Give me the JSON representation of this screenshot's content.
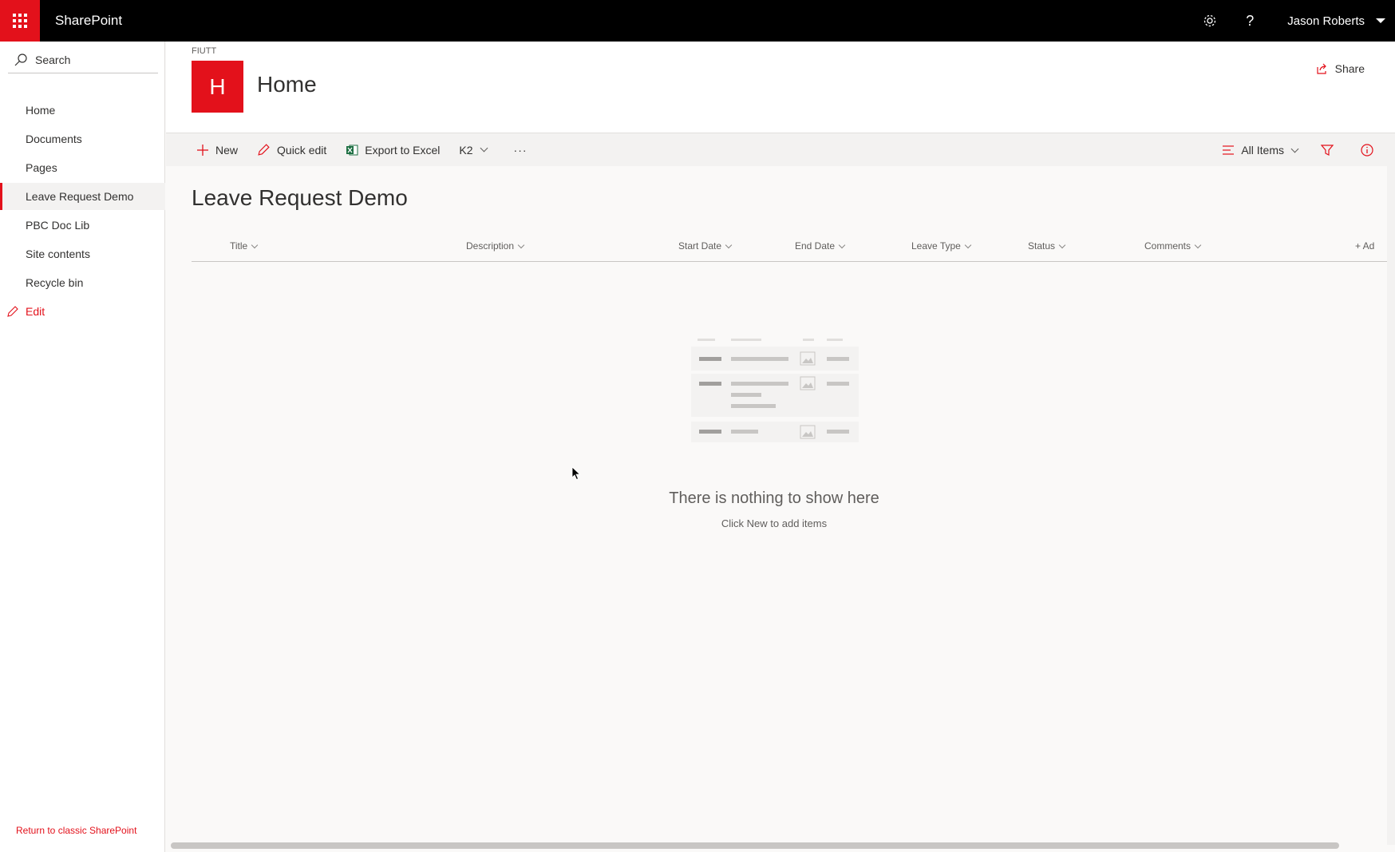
{
  "suite": {
    "app_name": "SharePoint",
    "user_name": "Jason Roberts",
    "icons": [
      "waffle-icon",
      "gear-icon",
      "help-icon",
      "chevron-down-icon"
    ]
  },
  "leftnav": {
    "search_label": "Search",
    "items": [
      {
        "label": "Home"
      },
      {
        "label": "Documents"
      },
      {
        "label": "Pages"
      },
      {
        "label": "Leave Request Demo",
        "selected": true
      },
      {
        "label": "PBC Doc Lib"
      },
      {
        "label": "Site contents"
      },
      {
        "label": "Recycle bin"
      }
    ],
    "edit_label": "Edit",
    "return_classic": "Return to classic SharePoint"
  },
  "header": {
    "breadcrumb": "FIUTT",
    "logo_letter": "H",
    "site_title": "Home",
    "share_label": "Share"
  },
  "commandbar": {
    "new_label": "New",
    "quick_edit_label": "Quick edit",
    "export_label": "Export to Excel",
    "k2_label": "K2",
    "more_label": "···",
    "view_label": "All Items"
  },
  "list": {
    "title": "Leave Request Demo",
    "columns": [
      "Title",
      "Description",
      "Start Date",
      "End Date",
      "Leave Type",
      "Status",
      "Comments"
    ],
    "add_column_label": "+ Ad",
    "empty_title": "There is nothing to show here",
    "empty_subtitle": "Click New to add items"
  },
  "colors": {
    "accent": "#e3111b",
    "suitebar": "#000000",
    "excel_green": "#1d6f42"
  }
}
